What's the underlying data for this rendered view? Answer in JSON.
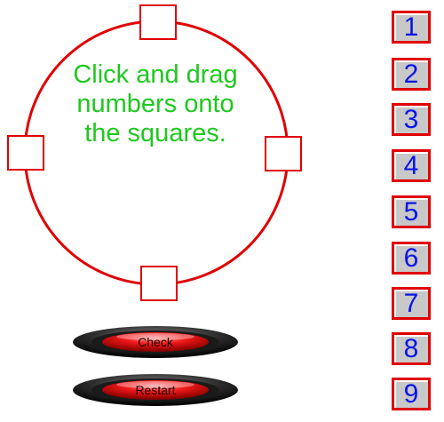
{
  "game": {
    "instructions": "Click and drag numbers onto the squares.",
    "colors": {
      "circle": "#e00000",
      "instruction_text": "#1ec81e",
      "tile_face": "#c8c8c8",
      "tile_border": "#e00000",
      "tile_number": "#0a14e6",
      "button_red": "#e00000"
    }
  },
  "slots": [
    {
      "id": "top",
      "value": ""
    },
    {
      "id": "left",
      "value": ""
    },
    {
      "id": "right",
      "value": ""
    },
    {
      "id": "bottom",
      "value": ""
    }
  ],
  "tiles": [
    "1",
    "2",
    "3",
    "4",
    "5",
    "6",
    "7",
    "8",
    "9"
  ],
  "buttons": {
    "check": "Check",
    "restart": "Restart"
  }
}
